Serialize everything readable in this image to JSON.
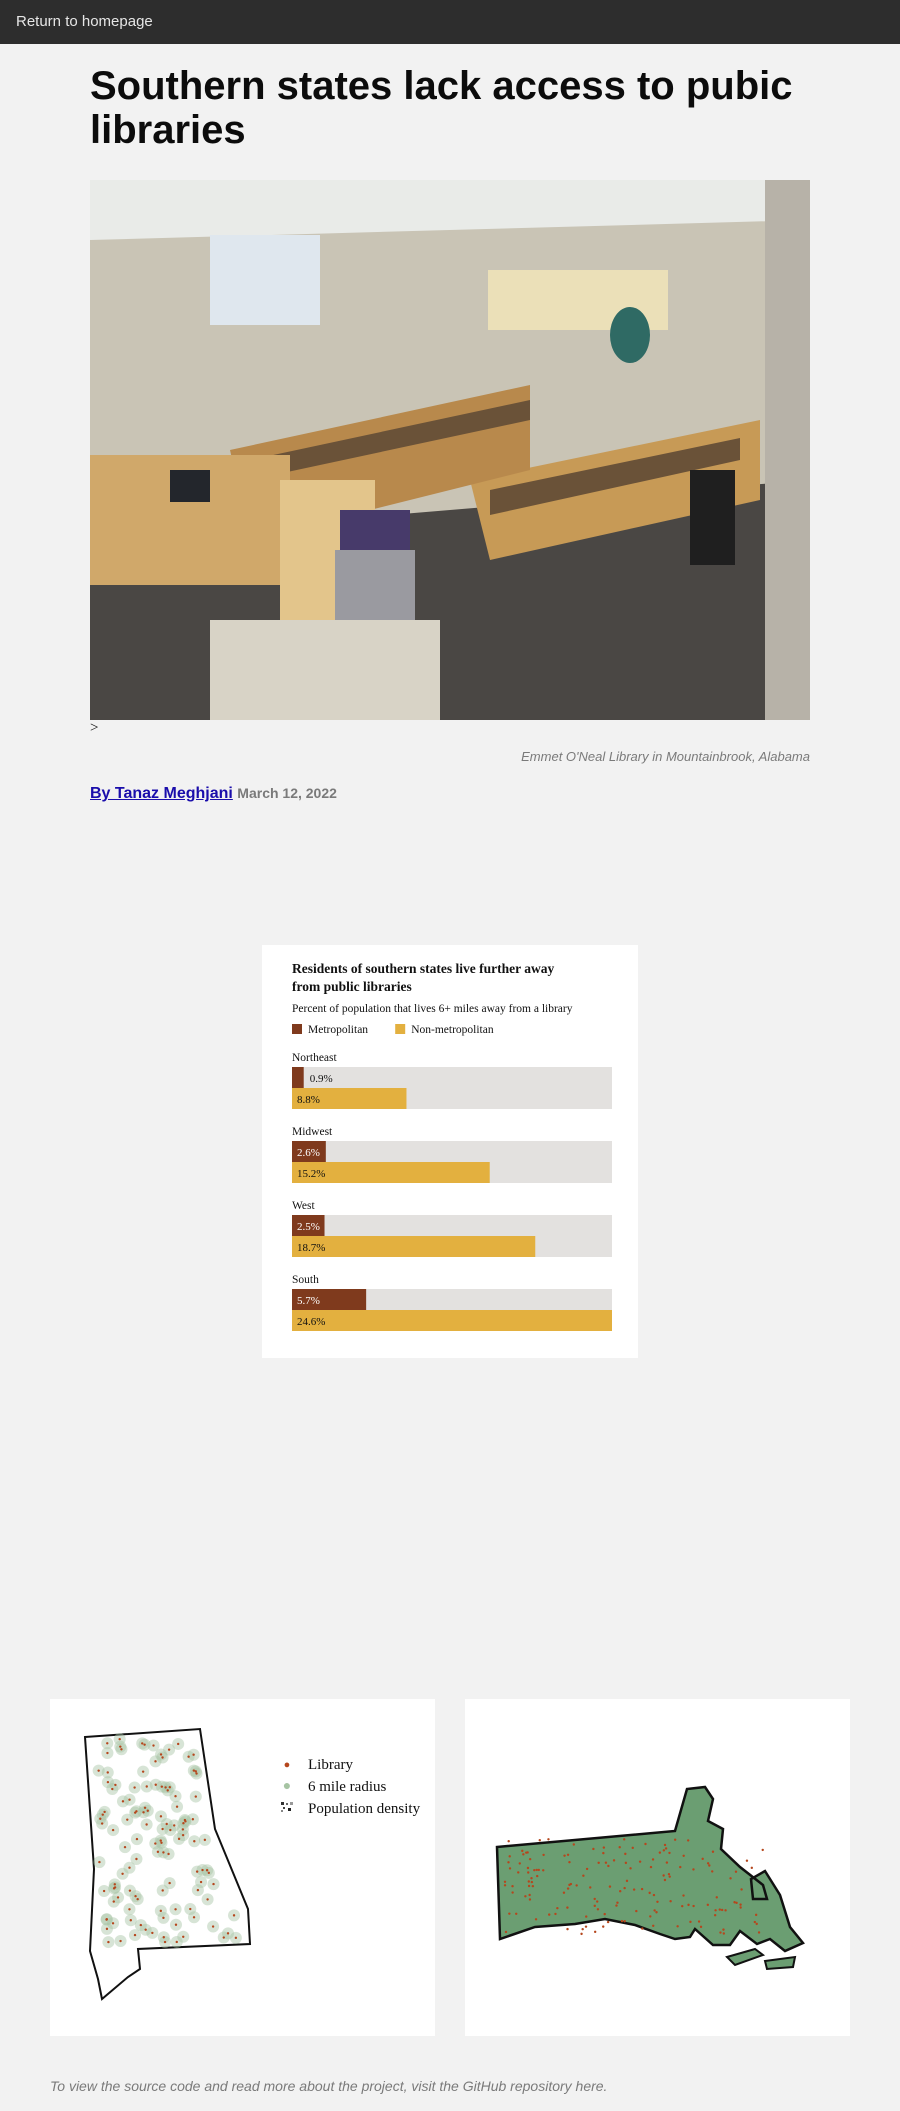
{
  "nav": {
    "home_link": "Return to homepage"
  },
  "article": {
    "title": "Southern states lack access to pubic libraries",
    "stray_char": ">",
    "photo_caption": "Emmet O'Neal Library in Mountainbrook, Alabama",
    "author": "By Tanaz Meghjani",
    "date": "March 12, 2022"
  },
  "chart_data": {
    "type": "bar",
    "title": "Residents of southern states live further away from public libraries",
    "subtitle": "Percent of population that lives 6+ miles away from a library",
    "legend_placement": "top-left",
    "ylim": [
      0,
      24.6
    ],
    "categories": [
      "Northeast",
      "Midwest",
      "West",
      "South"
    ],
    "series": [
      {
        "name": "Metropolitan",
        "color": "#7f3a1d",
        "values": [
          0.9,
          2.6,
          2.5,
          5.7
        ],
        "labels": [
          "0.9%",
          "2.6%",
          "2.5%",
          "5.7%"
        ]
      },
      {
        "name": "Non-metropolitan",
        "color": "#e3b03f",
        "values": [
          8.8,
          15.2,
          18.7,
          24.6
        ],
        "labels": [
          "8.8%",
          "15.2%",
          "18.7%",
          "24.6%"
        ]
      }
    ],
    "track_color": "#e3e1df"
  },
  "map_legend": {
    "library": "Library",
    "radius": "6 mile radius",
    "density": "Population density"
  },
  "colors": {
    "library_dot": "#b5471d",
    "radius_fill": "#a6c4a3",
    "map_fill": "#6b9e72"
  },
  "footer": {
    "text": "To view the source code and read more about the project, visit the GitHub repository here."
  }
}
